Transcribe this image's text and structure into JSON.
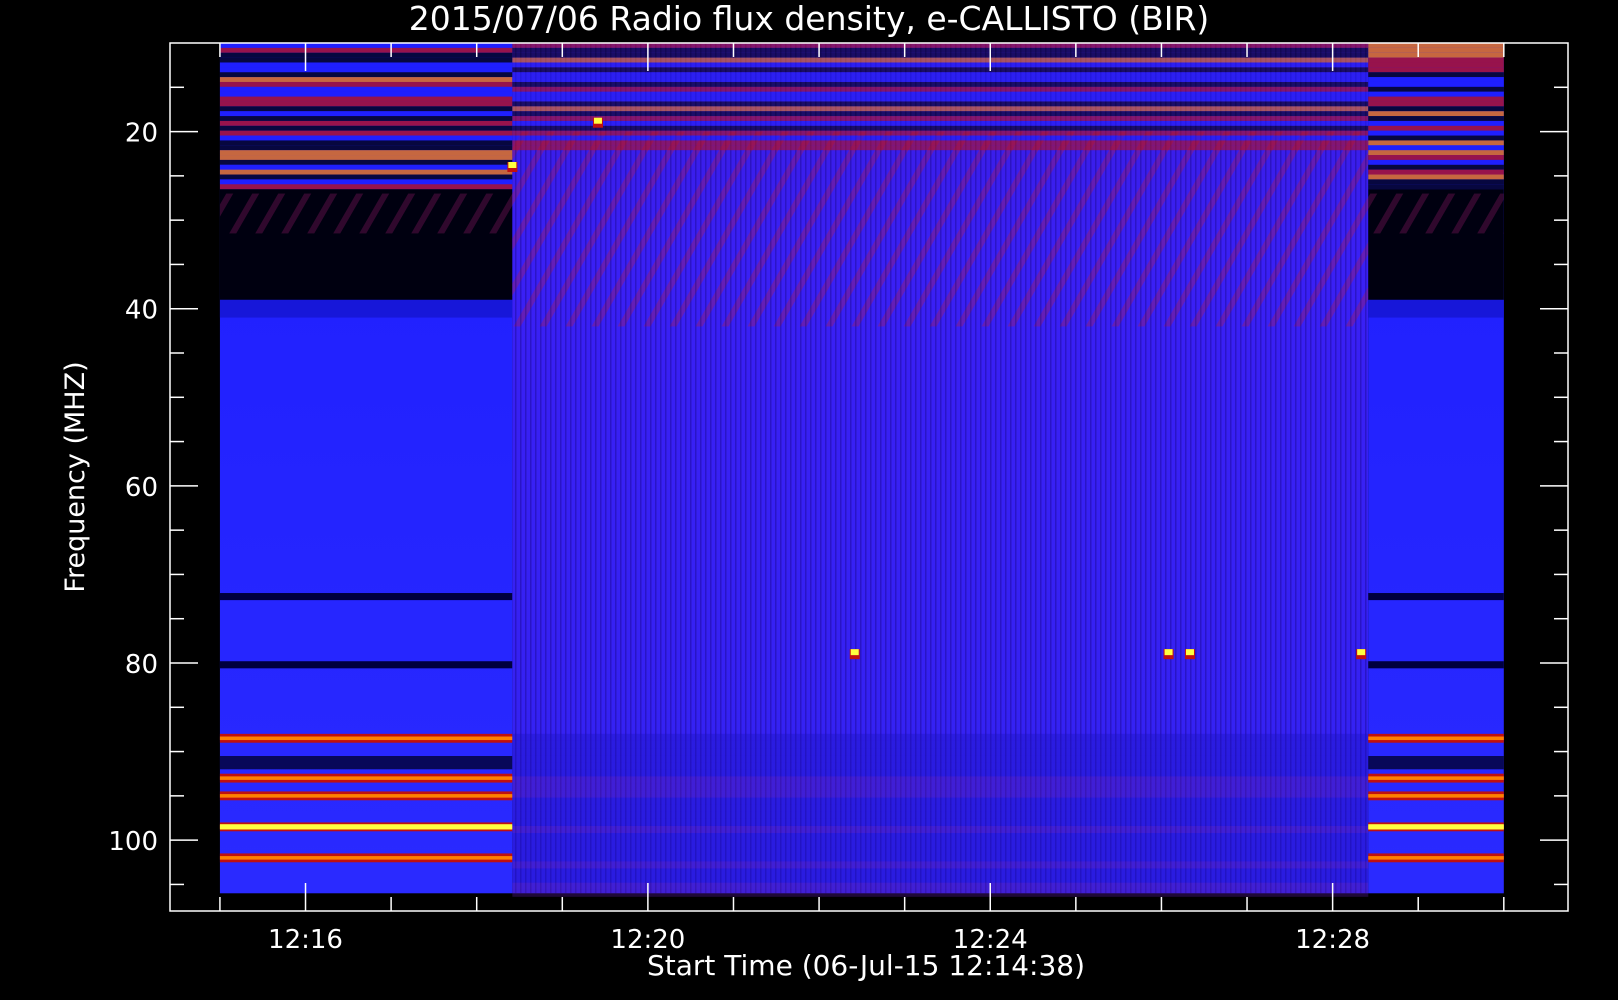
{
  "chart_data": {
    "type": "heatmap",
    "title": "2015/07/06  Radio flux density, e-CALLISTO (BIR)",
    "xlabel": "Start Time (06-Jul-15 12:14:38)",
    "ylabel": "Frequency (MHZ)",
    "x_unit": "minutes",
    "xlim": [
      "12:14:25",
      "12:30:45"
    ],
    "ylim": [
      108,
      10
    ],
    "data_x_range": [
      "12:15:00",
      "12:30:00"
    ],
    "data_y_range": [
      10,
      106
    ],
    "x_major_ticks": [
      "12:16",
      "12:20",
      "12:24",
      "12:28"
    ],
    "x_minor_step_minutes": 1,
    "y_major_ticks": [
      20,
      40,
      60,
      80,
      100
    ],
    "y_minor_step": 5,
    "colormap": [
      "#000000",
      "#2020ff",
      "#c01010",
      "#ff8000",
      "#ffff40"
    ],
    "segments": [
      {
        "start": "12:15:00",
        "end": "12:18:25",
        "mode": "standard"
      },
      {
        "start": "12:18:25",
        "end": "12:28:25",
        "mode": "enhanced"
      },
      {
        "start": "12:28:25",
        "end": "12:30:00",
        "mode": "standard"
      }
    ],
    "intense_bands_mhz": [
      88.5,
      93,
      95,
      98.5,
      102
    ],
    "dark_bands_mhz": [
      72.5,
      80.2
    ],
    "hot_spots": [
      {
        "time": "12:18:25",
        "freq": 24
      },
      {
        "time": "12:19:25",
        "freq": 19
      },
      {
        "time": "12:22:25",
        "freq": 79
      },
      {
        "time": "12:26:05",
        "freq": 79
      },
      {
        "time": "12:26:20",
        "freq": 79
      },
      {
        "time": "12:28:20",
        "freq": 79
      }
    ]
  }
}
